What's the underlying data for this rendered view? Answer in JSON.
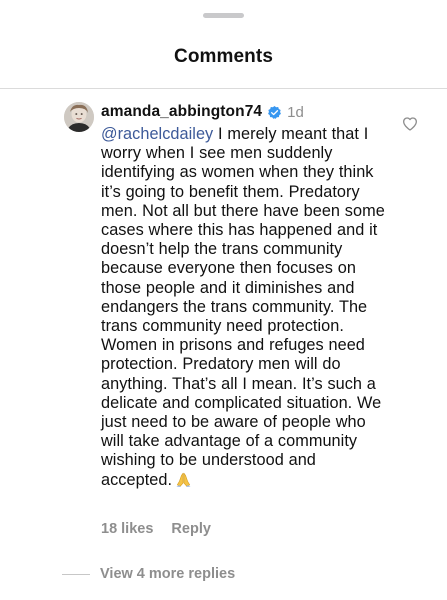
{
  "sheet": {
    "title": "Comments"
  },
  "comment": {
    "username": "amanda_abbington74",
    "verified_icon": "verified-badge-icon",
    "timestamp": "1d",
    "mention": "@rachelcdailey",
    "text": " I merely meant that I worry when I see men suddenly identifying as women when they think it’s going to benefit them. Predatory men. Not all but there have been some cases where this has happened and it doesn’t help the trans community because everyone then focuses on those people and it diminishes and endangers the trans community. The trans community need protection. Women in prisons and refuges need protection. Predatory men will do anything. That’s all I mean. It’s such a delicate and complicated situation. We just need to be aware of people who will take advantage of a community wishing to be understood and accepted.",
    "emoji": "folded-hands-emoji",
    "likes": "18 likes",
    "reply_label": "Reply",
    "like_icon": "heart-outline-icon"
  },
  "replies": {
    "label": "View 4 more replies"
  },
  "colors": {
    "mention": "#3d5a99",
    "secondary_text": "#8e8e8e",
    "verified": "#3897f0",
    "divider": "#dbdbdb"
  }
}
